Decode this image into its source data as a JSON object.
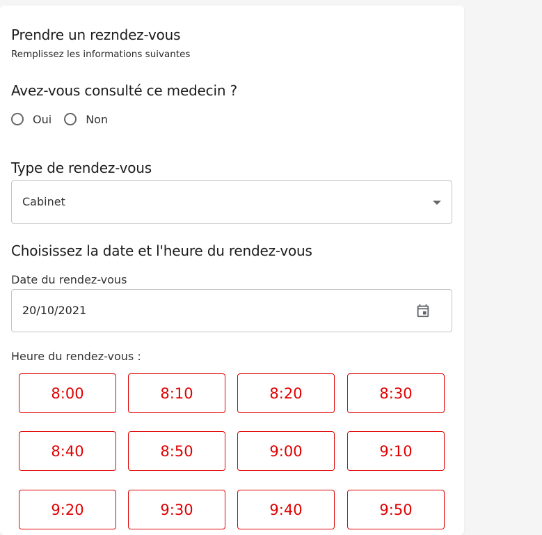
{
  "header": {
    "title": "Prendre un rezndez-vous",
    "subtitle": "Remplissez les informations suivantes"
  },
  "consultation": {
    "question": "Avez-vous consulté ce medecin ?",
    "options": [
      "Oui",
      "Non"
    ]
  },
  "appointment_type": {
    "label": "Type de rendez-vous",
    "selected": "Cabinet"
  },
  "datetime": {
    "section_title": "Choisissez la date et l'heure du rendez-vous",
    "date_label": "Date du rendez-vous",
    "date_value": "20/10/2021",
    "time_label": "Heure du rendez-vous :",
    "slots": [
      "8:00",
      "8:10",
      "8:20",
      "8:30",
      "8:40",
      "8:50",
      "9:00",
      "9:10",
      "9:20",
      "9:30",
      "9:40",
      "9:50"
    ]
  },
  "colors": {
    "accent": "#e00000",
    "border": "#c4c4c4",
    "background": "#f5f5f5"
  }
}
